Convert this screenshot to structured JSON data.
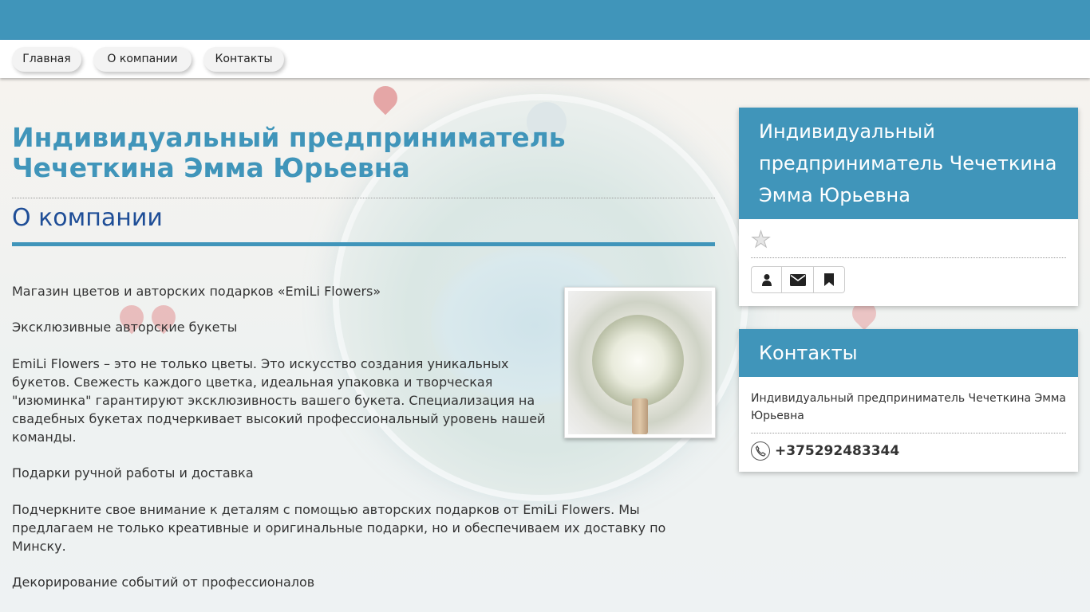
{
  "nav": {
    "items": [
      {
        "label": "Главная"
      },
      {
        "label": "О компании"
      },
      {
        "label": "Контакты"
      }
    ]
  },
  "main": {
    "title": "Индивидуальный предприниматель Чечеткина Эмма Юрьевна",
    "section_title": "О компании",
    "paragraphs": [
      "Магазин цветов и авторских подарков «EmiLi Flowers»",
      "Эксклюзивные авторские букеты",
      "EmiLi Flowers – это не только цветы. Это искусство создания уникальных букетов. Свежесть каждого цветка, идеальная упаковка и творческая \"изюминка\" гарантируют эксклюзивность вашего букета. Специализация на свадебных букетах подчеркивает высокий профессиональный уровень нашей команды.",
      "Подарки ручной работы и доставка",
      "Подчеркните свое внимание к деталям с помощью авторских подарков от EmiLi Flowers. Мы предлагаем не только креативные и оригинальные подарки, но и обеспечиваем их доставку по Минску.",
      "Декорирование событий от профессионалов"
    ]
  },
  "company_card": {
    "title": "Индивидуальный предприниматель Чечеткина Эмма Юрьевна",
    "rating_icon": "star-icon",
    "buttons": [
      {
        "icon": "user-icon"
      },
      {
        "icon": "envelope-icon"
      },
      {
        "icon": "bookmark-icon"
      }
    ]
  },
  "contacts_card": {
    "title": "Контакты",
    "name": "Индивидуальный предприниматель Чечеткина Эмма Юрьевна",
    "phone_icon": "phone-icon",
    "phone": "+375292483344"
  },
  "colors": {
    "accent": "#4095ba",
    "section_title": "#1f4e97"
  }
}
